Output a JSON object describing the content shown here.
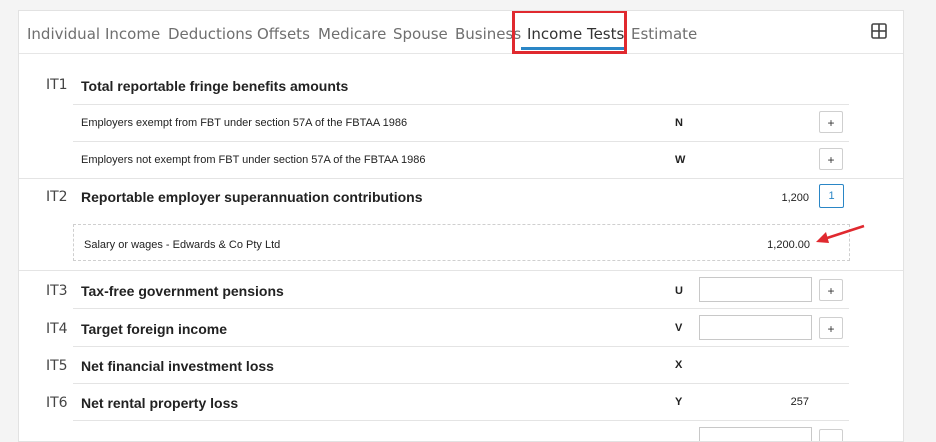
{
  "tabs": [
    {
      "label": "Individual"
    },
    {
      "label": "Income"
    },
    {
      "label": "Deductions"
    },
    {
      "label": "Offsets"
    },
    {
      "label": "Medicare"
    },
    {
      "label": "Spouse"
    },
    {
      "label": "Business"
    },
    {
      "label": "Income Tests"
    },
    {
      "label": "Estimate"
    }
  ],
  "active_tab": "Income Tests",
  "layout_icon": "grid-layout-icon",
  "accent_color": "#2a86c6",
  "highlight_color": "#e0292f",
  "it1": {
    "code": "IT1",
    "title": "Total reportable fringe benefits amounts",
    "items": [
      {
        "label": "Employers exempt from FBT under section 57A of the FBTAA 1986",
        "letter": "N",
        "button": "+"
      },
      {
        "label": "Employers not exempt from FBT under section 57A of the FBTAA 1986",
        "letter": "W",
        "button": "+"
      }
    ]
  },
  "it2": {
    "code": "IT2",
    "title": "Reportable employer superannuation contributions",
    "value": "1,200",
    "count": "1",
    "detail": {
      "label": "Salary or wages - Edwards & Co Pty Ltd",
      "value": "1,200.00"
    }
  },
  "it3": {
    "code": "IT3",
    "title": "Tax-free government pensions",
    "letter": "U",
    "input_value": "",
    "button": "+"
  },
  "it4": {
    "code": "IT4",
    "title": "Target foreign income",
    "letter": "V",
    "input_value": "",
    "button": "+"
  },
  "it5": {
    "code": "IT5",
    "title": "Net financial investment loss",
    "letter": "X"
  },
  "it6": {
    "code": "IT6",
    "title": "Net rental property loss",
    "letter": "Y",
    "value": "257"
  }
}
